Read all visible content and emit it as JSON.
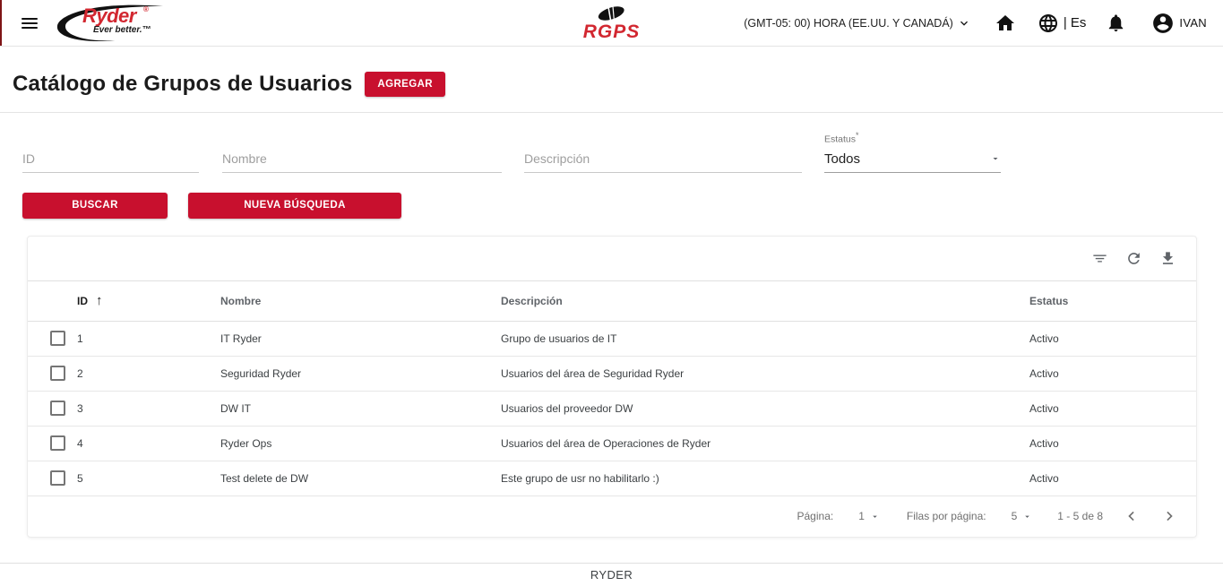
{
  "brand": {
    "ryder_logo_text": "Ryder",
    "ryder_reg_mark": "®",
    "ryder_tagline": "Ever better.™",
    "center_logo_text": "RGPS",
    "accent_red": "#c8102e",
    "logo_red": "#d22730"
  },
  "header": {
    "timezone_label": "(GMT-05: 00) HORA (EE.UU. Y CANADÁ)",
    "language_label": "| Es",
    "user_name": "IVAN"
  },
  "page": {
    "title": "Catálogo de Grupos de Usuarios",
    "add_button_label": "AGREGAR"
  },
  "search_form": {
    "id_placeholder": "ID",
    "name_placeholder": "Nombre",
    "description_placeholder": "Descripción",
    "status_label": "Estatus",
    "status_required_mark": "*",
    "status_value": "Todos",
    "search_button_label": "BUSCAR",
    "new_search_button_label": "NUEVA BÚSQUEDA"
  },
  "table": {
    "columns": {
      "id": "ID",
      "name": "Nombre",
      "description": "Descripción",
      "status": "Estatus"
    },
    "sort_ascending_icon": "↑",
    "rows": [
      {
        "id": "1",
        "name": "IT Ryder",
        "description": "Grupo de usuarios de IT",
        "status": "Activo"
      },
      {
        "id": "2",
        "name": "Seguridad Ryder",
        "description": "Usuarios del área de Seguridad Ryder",
        "status": "Activo"
      },
      {
        "id": "3",
        "name": "DW IT",
        "description": "Usuarios del proveedor DW",
        "status": "Activo"
      },
      {
        "id": "4",
        "name": "Ryder Ops",
        "description": "Usuarios del área de Operaciones de Ryder",
        "status": "Activo"
      },
      {
        "id": "5",
        "name": "Test delete de DW",
        "description": "Este grupo de usr no habilitarlo :)",
        "status": "Activo"
      }
    ]
  },
  "pagination": {
    "page_label": "Página:",
    "page_value": "1",
    "rows_per_page_label": "Filas por página:",
    "rows_per_page_value": "5",
    "range_label": "1 - 5 de 8"
  },
  "footer": {
    "text": "RYDER"
  }
}
